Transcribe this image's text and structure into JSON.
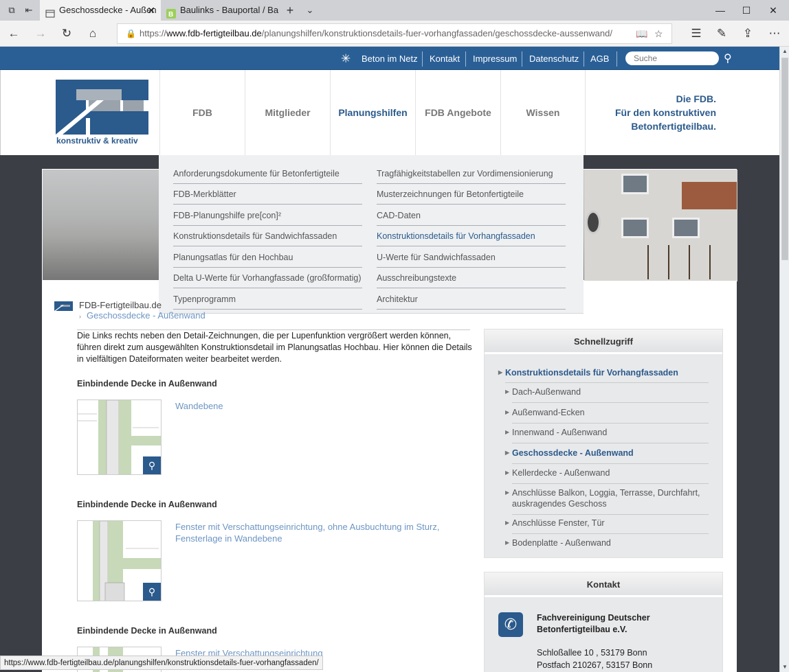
{
  "browser": {
    "tabs": [
      {
        "title": "Geschossdecke - Außen",
        "active": true
      },
      {
        "title": "Baulinks - Bauportal / Baurr",
        "active": false
      }
    ],
    "url_prefix": "https://",
    "url_domain": "www.fdb-fertigteilbau.de",
    "url_path": "/planungshilfen/konstruktionsdetails-fuer-vorhangfassaden/geschossdecke-aussenwand/",
    "status_url": "https://www.fdb-fertigteilbau.de/planungshilfen/konstruktionsdetails-fuer-vorhangfassaden/"
  },
  "topbar": {
    "links": [
      "Beton im Netz",
      "Kontakt",
      "Impressum",
      "Datenschutz",
      "AGB"
    ],
    "search_placeholder": "Suche"
  },
  "header": {
    "logo_tagline": "konstruktiv & kreativ",
    "nav": [
      "FDB",
      "Mitglieder",
      "Planungshilfen",
      "FDB Angebote",
      "Wissen"
    ],
    "active_nav": "Planungshilfen",
    "claim": [
      "Die FDB.",
      "Für den konstruktiven",
      "Betonfertigteilbau."
    ]
  },
  "dropdown": {
    "left": [
      "Anforderungsdokumente für Betonfertigteile",
      "FDB-Merkblätter",
      "FDB-Planungshilfe pre[con]²",
      "Konstruktionsdetails für Sandwichfassaden",
      "Planungsatlas für den Hochbau",
      "Delta U-Werte für Vorhangfassade (großformatig)",
      "Typenprogramm"
    ],
    "right": [
      "Tragfähigkeitstabellen zur Vordimensionierung",
      "Musterzeichnungen für Betonfertigteile",
      "CAD-Daten",
      "Konstruktionsdetails für Vorhangfassaden",
      "U-Werte für Sandwichfassaden",
      "Ausschreibungstexte",
      "Architektur"
    ],
    "active": "Konstruktionsdetails für Vorhangfassaden"
  },
  "breadcrumb": {
    "home": "FDB-Fertigteilbau.de",
    "current": "Geschossdecke - Außenwand"
  },
  "main": {
    "intro": "Die Links rechts neben den Detail-Zeichnungen, die per Lupenfunktion vergrößert werden können, führen direkt zum ausgewählten Konstruktionsdetail im Planungsatlas Hochbau. Hier können die Details in vielfältigen Dateiformaten weiter bearbeitet werden.",
    "sections": [
      {
        "heading": "Einbindende Decke in Außenwand",
        "link": "Wandebene"
      },
      {
        "heading": "Einbindende Decke in Außenwand",
        "link": "Fenster mit Verschattungseinrichtung, ohne Ausbuchtung im Sturz, Fensterlage in Wandebene"
      },
      {
        "heading": "Einbindende Decke in Außenwand",
        "link": "Fenster mit Verschattungseinrichtung"
      }
    ]
  },
  "sidebar": {
    "quick_title": "Schnellzugriff",
    "quick_parent": "Konstruktionsdetails für Vorhangfassaden",
    "quick_items": [
      "Dach-Außenwand",
      "Außenwand-Ecken",
      "Innenwand - Außenwand",
      "Geschossdecke - Außenwand",
      "Kellerdecke - Außenwand",
      "Anschlüsse Balkon, Loggia, Terrasse, Durchfahrt, auskragendes Geschoss",
      "Anschlüsse Fenster, Tür",
      "Bodenplatte - Außenwand"
    ],
    "quick_active": "Geschossdecke - Außenwand",
    "contact_title": "Kontakt",
    "contact_org": "Fachvereinigung Deutscher Betonfertigteilbau e.V.",
    "contact_addr1": "Schloßallee 10 , 53179 Bonn",
    "contact_addr2": "Postfach 210267, 53157 Bonn"
  },
  "colors": {
    "brand_blue": "#2a5f96",
    "link_blue": "#6d95c4",
    "nav_active": "#2b5a8c"
  }
}
